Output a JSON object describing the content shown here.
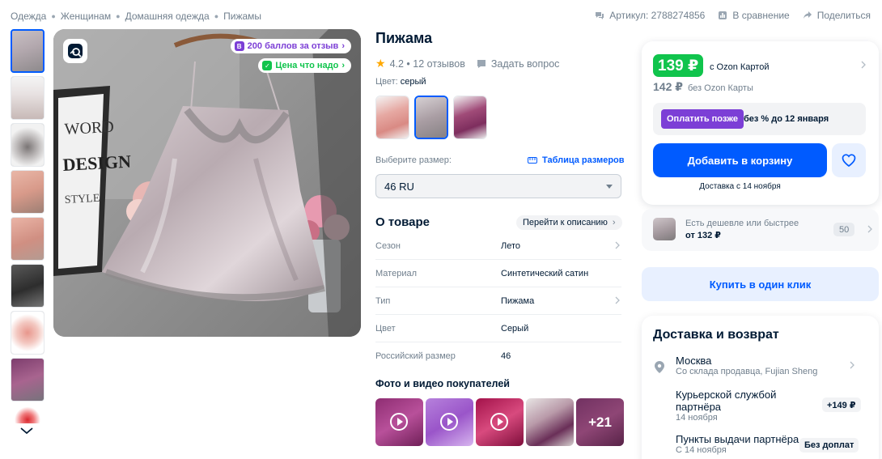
{
  "breadcrumbs": [
    "Одежда",
    "Женщинам",
    "Домашняя одежда",
    "Пижамы"
  ],
  "top_actions": {
    "article": "Артикул: 2788274856",
    "compare": "В сравнение",
    "share": "Поделиться"
  },
  "gallery": {
    "bonus_pill": "200 баллов за отзыв",
    "good_price_pill": "Цена что надо",
    "thumb_count": 9
  },
  "product": {
    "title": "Пижама",
    "rating": "4.2",
    "reviews": "12 отзывов",
    "ask_question": "Задать вопрос",
    "color_label": "Цвет:",
    "color_value": "серый",
    "size_label": "Выберите размер:",
    "size_table": "Таблица размеров",
    "size_selected": "46 RU"
  },
  "about": {
    "title": "О товаре",
    "goto_description": "Перейти к описанию",
    "props": [
      {
        "key": "Сезон",
        "value": "Лето"
      },
      {
        "key": "Материал",
        "value": "Синтетический сатин"
      },
      {
        "key": "Тип",
        "value": "Пижама"
      },
      {
        "key": "Цвет",
        "value": "Серый"
      },
      {
        "key": "Российский размер",
        "value": "46"
      }
    ]
  },
  "customer_photos": {
    "title": "Фото и видео покупателей",
    "more": "+21"
  },
  "buy": {
    "price_card": "139 ₽",
    "price_card_label": "с Ozon Картой",
    "price_regular": "142 ₽",
    "price_regular_label": "без Ozon Карты",
    "pay_later_button": "Оплатить позже",
    "pay_later_text": "без % до 12 января",
    "add_to_cart": "Добавить в корзину",
    "delivery_date": "Доставка с 14 ноября"
  },
  "cheaper": {
    "line1": "Есть дешевле или быстрее",
    "line2": "от 132 ₽",
    "count": "50"
  },
  "one_click": "Купить в один клик",
  "delivery": {
    "title": "Доставка и возврат",
    "city": "Москва",
    "city_sub": "Со склада продавца, Fujian Sheng",
    "courier": "Курьерской службой партнёра",
    "courier_date": "14 ноября",
    "courier_price": "+149 ₽",
    "pickup": "Пункты выдачи партнёра",
    "pickup_date": "С 14 ноября",
    "pickup_price": "Без доплат"
  },
  "colors": {
    "accent": "#005bff",
    "green": "#10c44c",
    "purple": "#7c3fd6",
    "star": "#ffa800"
  }
}
